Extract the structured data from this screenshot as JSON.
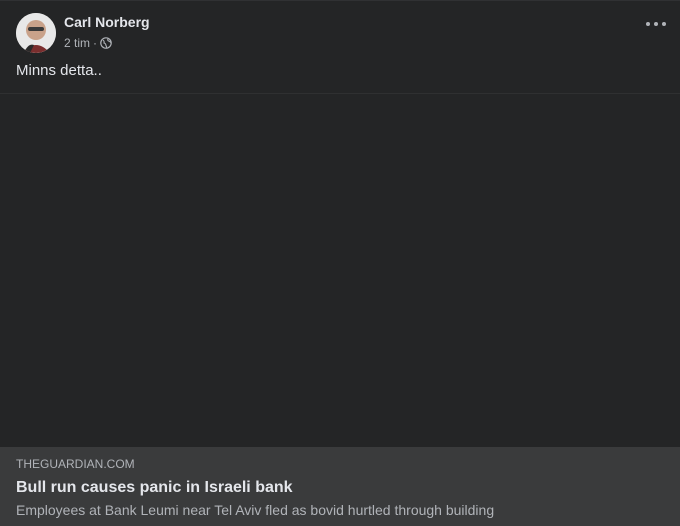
{
  "post": {
    "author": "Carl Norberg",
    "time": "2 tim",
    "separator": "·",
    "privacy_icon": "globe-icon",
    "more_icon": "more-options-icon",
    "text": "Minns detta.."
  },
  "link": {
    "domain": "THEGUARDIAN.COM",
    "title": "Bull run causes panic in Israeli bank",
    "description": "Employees at Bank Leumi near Tel Aviv fled as bovid hurtled through building"
  },
  "colors": {
    "card_bg": "#242526",
    "link_bg": "#3a3b3c",
    "primary_text": "#e4e6eb",
    "secondary_text": "#b0b3b8"
  }
}
